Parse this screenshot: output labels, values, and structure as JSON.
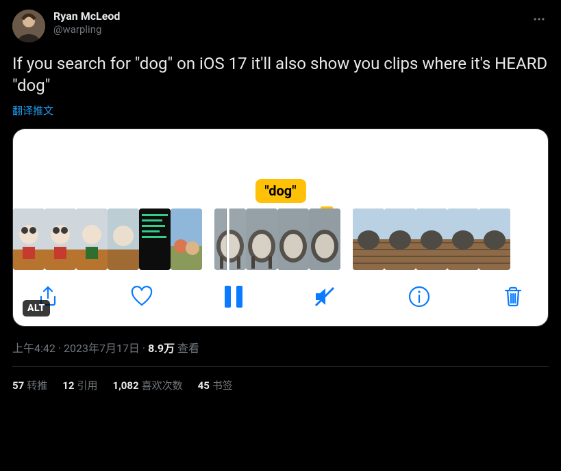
{
  "author": {
    "display_name": "Ryan McLeod",
    "handle": "@warpling"
  },
  "tweet_text": "If you search for \"dog\" on iOS 17 it'll also show you clips where it's HEARD \"dog\"",
  "translate_label": "翻译推文",
  "media": {
    "search_token": "\"dog\"",
    "alt_badge": "ALT"
  },
  "meta": {
    "time": "上午4:42",
    "date": "2023年7月17日",
    "views_count": "8.9万",
    "views_label": "查看"
  },
  "stats": {
    "retweets_count": "57",
    "retweets_label": "转推",
    "quotes_count": "12",
    "quotes_label": "引用",
    "likes_count": "1,082",
    "likes_label": "喜欢次数",
    "bookmarks_count": "45",
    "bookmarks_label": "书签"
  }
}
